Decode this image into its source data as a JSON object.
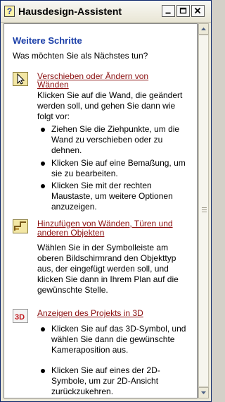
{
  "window": {
    "title": "Hausdesign-Assistent"
  },
  "content": {
    "heading": "Weitere Schritte",
    "intro": "Was möchten Sie als Nächstes tun?",
    "sections": [
      {
        "icon": "cursor-icon",
        "link_line1": "Verschieben oder Ändern von",
        "link_line2": "Wänden",
        "text": "Klicken Sie auf die Wand, die geändert werden soll, und gehen Sie dann wie folgt vor:",
        "bullets": [
          "Ziehen Sie die Ziehpunkte, um die Wand zu verschieben oder zu dehnen.",
          "Klicken Sie auf eine Bemaßung, um sie zu bearbeiten.",
          "Klicken Sie mit der rechten Maustaste, um weitere Optionen anzuzeigen."
        ]
      },
      {
        "icon": "add-wall-icon",
        "link_line1": "Hinzufügen von Wänden, Türen und",
        "link_line2": "anderen Objekten",
        "text": "Wählen Sie in der Symbolleiste am oberen Bildschirmrand den Objekttyp aus, der eingefügt werden soll, und klicken Sie dann in Ihrem Plan auf die gewünschte Stelle."
      },
      {
        "icon": "3d-icon",
        "icon_text": "3D",
        "link": "Anzeigen des Projekts in 3D",
        "bullets": [
          "Klicken Sie auf das 3D-Symbol, und wählen Sie dann die gewünschte Kameraposition aus.",
          "Klicken Sie auf eines der 2D-Symbole, um zur 2D-Ansicht zurückzukehren."
        ]
      }
    ]
  },
  "colors": {
    "heading": "#1b3fa8",
    "link": "#8b1010"
  }
}
